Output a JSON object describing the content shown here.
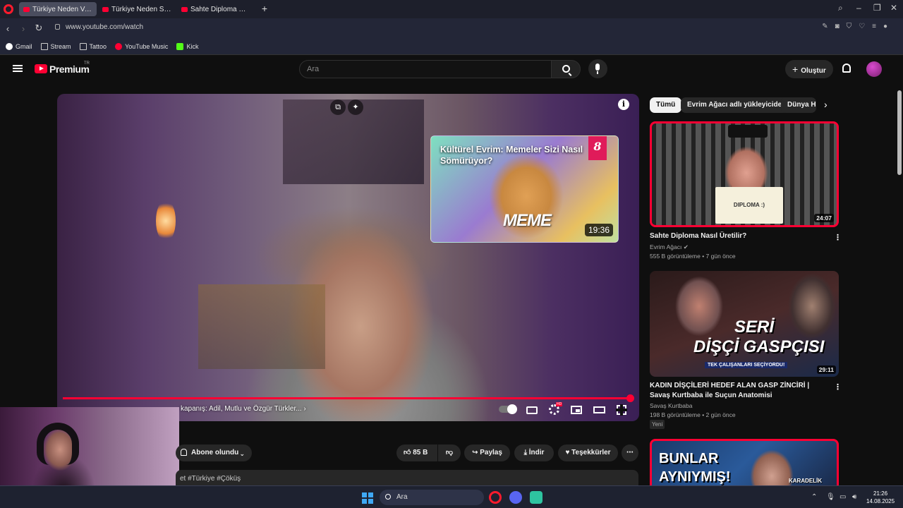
{
  "browser": {
    "tabs": [
      {
        "title": "Türkiye Neden Vahşileşti?",
        "active": true
      },
      {
        "title": "Türkiye Neden Sürekli Yan",
        "active": false
      },
      {
        "title": "Sahte Diploma Nasıl Üreti",
        "active": false
      }
    ],
    "new_tab": "+",
    "url": "www.youtube.com/watch",
    "bookmarks": [
      "Gmail",
      "Stream",
      "Tattoo",
      "YouTube Music",
      "Kick"
    ]
  },
  "youtube": {
    "logo_text": "Premium",
    "country": "TR",
    "search_placeholder": "Ara",
    "create_label": "Oluştur"
  },
  "player": {
    "endcard": {
      "title": "Kültürel Evrim: Memeler Sizi Nasıl Sömürüyor?",
      "badge": "8",
      "overlay_text": "MEME",
      "duration": "19:36"
    },
    "chapter": "kapanış: Adil, Mutlu ve Özgür Türkler...",
    "progress": 0.999
  },
  "actions": {
    "subscribe_label": "Abone olundu",
    "likes": "85 B",
    "share": "Paylaş",
    "download": "İndir",
    "thanks": "Teşekkürler",
    "description_snippet": "et #Türkiye #Çöküş"
  },
  "sidebar": {
    "chips": [
      "Tümü",
      "Evrim Ağacı adlı yükleyiciden",
      "Dünya H"
    ],
    "videos": [
      {
        "title": "Sahte Diploma Nasıl Üretilir?",
        "channel": "Evrim Ağacı",
        "meta": "555 B görüntüleme • 7 gün önce",
        "duration": "24:07",
        "thumb_text": "DIPLOMA :)"
      },
      {
        "title": "KADIN DİŞÇİLERİ HEDEF ALAN GASP ZİNCİRİ | Savaş Kurtbaba ile Suçun Anatomisi",
        "channel": "Savaş Kurtbaba",
        "meta": "198 B görüntüleme • 2 gün önce",
        "duration": "29:11",
        "badge": "Yeni",
        "thumb_text_1": "SERİ",
        "thumb_text_2": "DİŞÇİ GASPÇISI",
        "thumb_sub": "TEK ÇALIŞANLARI SEÇİYORDU!"
      },
      {
        "thumb_text_1": "BUNLAR",
        "thumb_text_2": "AYNIYMIŞ!",
        "thumb_text_3": "KARADELİK"
      }
    ]
  },
  "taskbar": {
    "search": "Ara",
    "time": "21:26",
    "date": "14.08.2025"
  },
  "colors": {
    "accent": "#ff0033",
    "background": "#0f0f0f"
  }
}
